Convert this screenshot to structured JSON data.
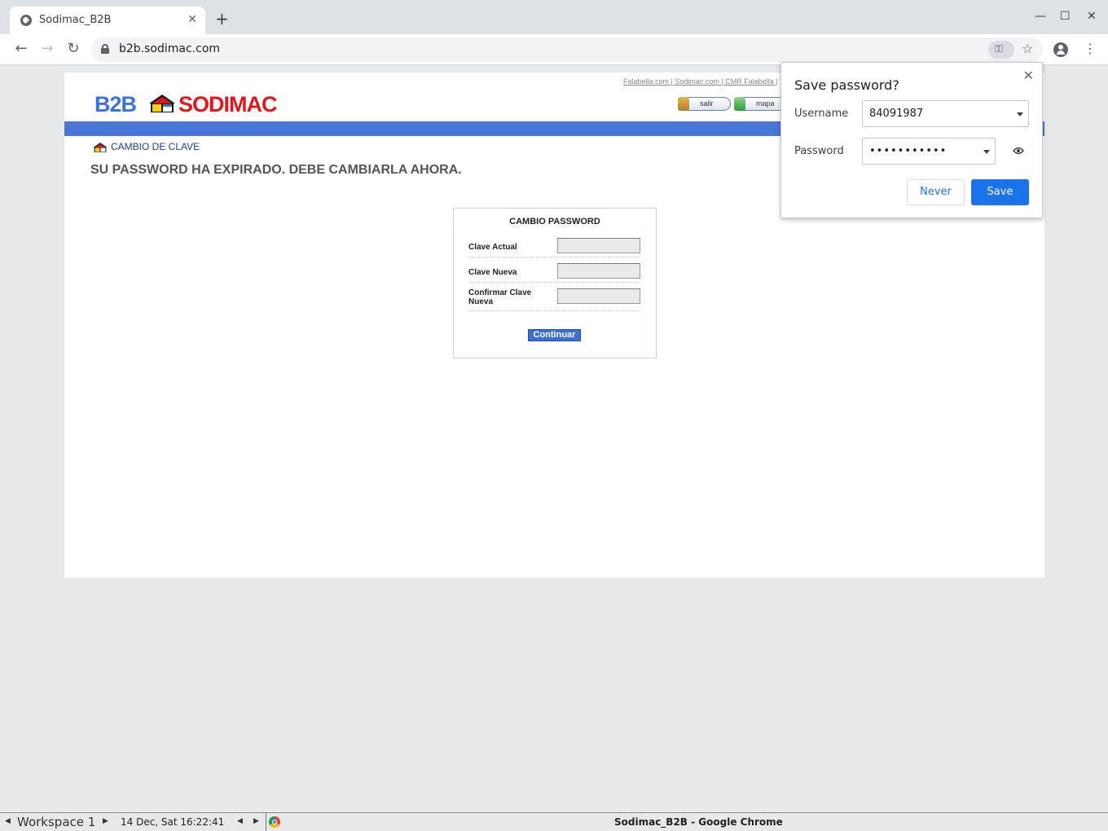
{
  "browser": {
    "tab_title": "Sodimac_B2B",
    "url": "b2b.sodimac.com",
    "new_tab_label": "+",
    "minimize": "—",
    "maximize": "☐",
    "close": "✕"
  },
  "site": {
    "top_links": "Falabella.com | Sodimac.com | CMR Falabella |",
    "logo_b2b": "B2B",
    "logo_sodimac": "SODIMAC",
    "btn_salir": "salir",
    "btn_mapa": "mapa",
    "section_title": "CAMBIO DE CLAVE",
    "expired_message": "SU PASSWORD HA EXPIRADO. DEBE CAMBIARLA AHORA.",
    "form": {
      "heading": "CAMBIO PASSWORD",
      "clave_actual": "Clave Actual",
      "clave_nueva": "Clave Nueva",
      "confirmar_clave": "Confirmar Clave Nueva",
      "continuar": "Continuar"
    }
  },
  "save_password": {
    "title": "Save password?",
    "username_label": "Username",
    "username_value": "84091987",
    "password_label": "Password",
    "password_value": "•••••••••••",
    "never_label": "Never",
    "save_label": "Save"
  },
  "taskbar": {
    "workspace": "Workspace 1",
    "datetime": "14 Dec, Sat 16:22:41",
    "window_title": "Sodimac_B2B - Google Chrome"
  },
  "colors": {
    "sodimac_red": "#e3161b",
    "b2b_blue": "#3b74d9",
    "header_bar": "#4a76d8",
    "chrome_blue": "#1a73e8"
  }
}
